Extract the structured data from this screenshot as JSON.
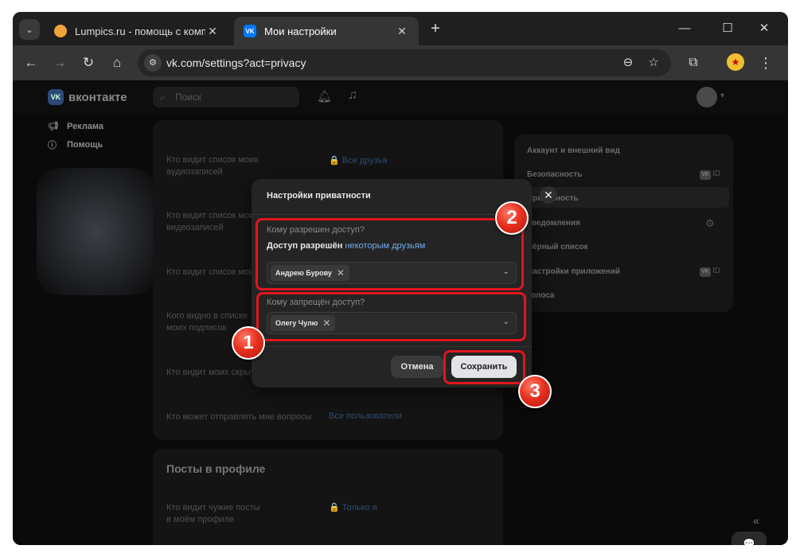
{
  "browser": {
    "tabs": [
      {
        "title": "Lumpics.ru - помощь с компью",
        "close": "✕"
      },
      {
        "title": "Мои настройки",
        "close": "✕"
      }
    ],
    "new_tab": "+",
    "url": "vk.com/settings?act=privacy",
    "window_controls": {
      "minimize": "—",
      "maximize": "☐",
      "close": "✕"
    },
    "icons": {
      "back": "←",
      "forward": "→",
      "reload": "↻",
      "home": "⌂",
      "zoom": "⊖",
      "star": "☆",
      "extensions": "⧉",
      "menu": "⋮",
      "tab_menu": "⌄",
      "site_info": "⚙"
    }
  },
  "vk": {
    "logo_text": "вконтакте",
    "logo_mark": "VK",
    "search_placeholder": "Поиск",
    "left_nav": [
      {
        "label": "Реклама",
        "icon": "megaphone-icon"
      },
      {
        "label": "Помощь",
        "icon": "help-icon"
      }
    ],
    "settings_rows": [
      {
        "question": "Кто видит список моих аудиозаписей",
        "value": "🔒 Все друзья"
      },
      {
        "question": "Кто видит список моих видеозаписей",
        "value": ""
      },
      {
        "question": "Кто видит список моих",
        "value": ""
      },
      {
        "question": "Кого видно в списке моих подписок",
        "value": ""
      },
      {
        "question": "Кто видит моих скрытых",
        "value": ""
      },
      {
        "question": "Кто может отправлять мне вопросы",
        "value": "Все пользователи"
      }
    ],
    "posts_section_title": "Посты в профиле",
    "posts_row": {
      "question": "Кто видит чужие посты в моём профиле",
      "value": "🔒 Только я"
    },
    "right_menu": [
      {
        "label": "Аккаунт и внешний вид"
      },
      {
        "label": "Безопасность",
        "badge": "ID"
      },
      {
        "label": "Приватность"
      },
      {
        "label": "Уведомления"
      },
      {
        "label": "Чёрный список"
      },
      {
        "label": "Настройки приложений",
        "badge": "ID"
      },
      {
        "label": "Голоса"
      }
    ],
    "collapse_icon": "«",
    "chat_icon": "💬"
  },
  "modal": {
    "title": "Настройки приватности",
    "allowed_label": "Кому разрешен доступ?",
    "allowed_text_bold": "Доступ разрешён",
    "allowed_text_link": "некоторым друзьям",
    "allowed_chip": "Андрею Бурову",
    "denied_label": "Кому запрещён доступ?",
    "denied_chip": "Олегу Чулю",
    "cancel_label": "Отмена",
    "save_label": "Сохранить",
    "close": "✕"
  },
  "annotations": [
    {
      "number": "1",
      "color": "#e0161e"
    },
    {
      "number": "2",
      "color": "#e0161e"
    },
    {
      "number": "3",
      "color": "#e0161e"
    }
  ]
}
